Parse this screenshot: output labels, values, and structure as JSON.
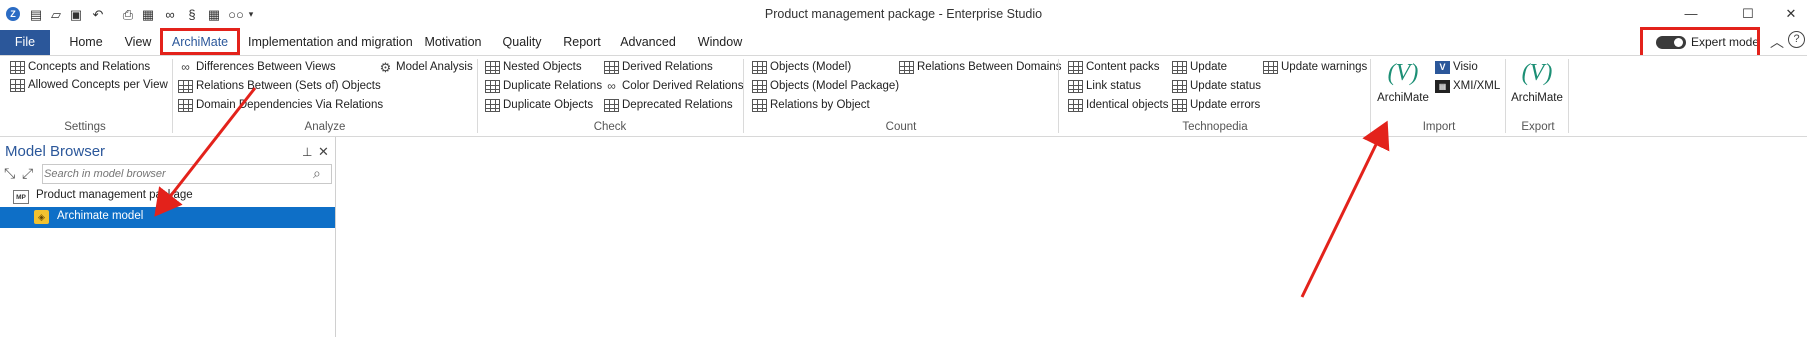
{
  "window": {
    "title": "Product management package - Enterprise Studio"
  },
  "tabs": {
    "file": "File",
    "items": [
      "Home",
      "View",
      "ArchiMate",
      "Implementation and migration",
      "Motivation",
      "Quality",
      "Report",
      "Advanced",
      "Window"
    ],
    "active": "ArchiMate"
  },
  "ribbon": {
    "settings": {
      "label": "Settings",
      "items": [
        "Concepts and Relations",
        "Allowed Concepts per View"
      ]
    },
    "analyze": {
      "label": "Analyze",
      "items": [
        "Differences Between Views",
        "Relations Between (Sets of) Objects",
        "Domain Dependencies Via Relations",
        "Model Analysis"
      ]
    },
    "check": {
      "label": "Check",
      "items": [
        "Nested Objects",
        "Duplicate Relations",
        "Duplicate Objects",
        "Derived Relations",
        "Color Derived Relations",
        "Deprecated Relations"
      ]
    },
    "count": {
      "label": "Count",
      "items": [
        "Objects (Model)",
        "Objects (Model Package)",
        "Relations by Object",
        "Relations Between Domains"
      ]
    },
    "technopedia": {
      "label": "Technopedia",
      "items": [
        "Content packs",
        "Link status",
        "Identical objects",
        "Update",
        "Update status",
        "Update errors",
        "Update warnings"
      ]
    },
    "import": {
      "label": "Import",
      "big_button": "ArchiMate",
      "items": [
        "Visio",
        "XMI/XML"
      ]
    },
    "export": {
      "label": "Export",
      "big_button": "ArchiMate"
    }
  },
  "expert_mode": {
    "label": "Expert mode",
    "enabled": true
  },
  "model_browser": {
    "title": "Model Browser",
    "search_placeholder": "Search in model browser",
    "tree": {
      "root": "Product management package",
      "child": "Archimate model"
    }
  },
  "colors": {
    "accent": "#2b579a",
    "selection": "#0e6fc7",
    "annotation": "#e3221b"
  }
}
